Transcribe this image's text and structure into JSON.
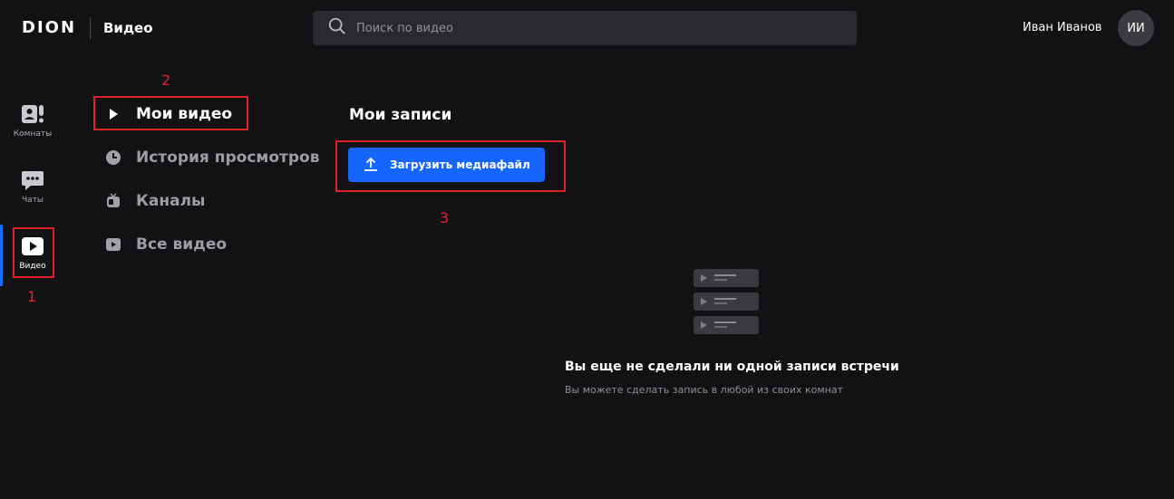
{
  "header": {
    "logo": "DION",
    "section": "Видео",
    "search_placeholder": "Поиск по видео",
    "user_name": "Иван Иванов",
    "avatar_initials": "ИИ"
  },
  "rail": {
    "items": [
      {
        "label": "Комнаты",
        "icon": "rooms-icon"
      },
      {
        "label": "Чаты",
        "icon": "chat-icon"
      },
      {
        "label": "Видео",
        "icon": "video-icon",
        "active": true
      }
    ]
  },
  "subnav": {
    "items": [
      {
        "label": "Мои видео",
        "icon": "play-icon",
        "active": true
      },
      {
        "label": "История просмотров",
        "icon": "clock-icon"
      },
      {
        "label": "Каналы",
        "icon": "tv-icon"
      },
      {
        "label": "Все видео",
        "icon": "video-play-icon"
      }
    ]
  },
  "main": {
    "title": "Мои записи",
    "upload_label": "Загрузить медиафайл",
    "empty_title": "Вы еще не сделали ни одной записи встречи",
    "empty_subtitle": "Вы можете сделать запись в любой из своих комнат"
  },
  "annotations": {
    "n1": "1",
    "n2": "2",
    "n3": "3"
  },
  "colors": {
    "accent": "#1565ff",
    "background": "#121214",
    "highlight": "#e0232a"
  }
}
